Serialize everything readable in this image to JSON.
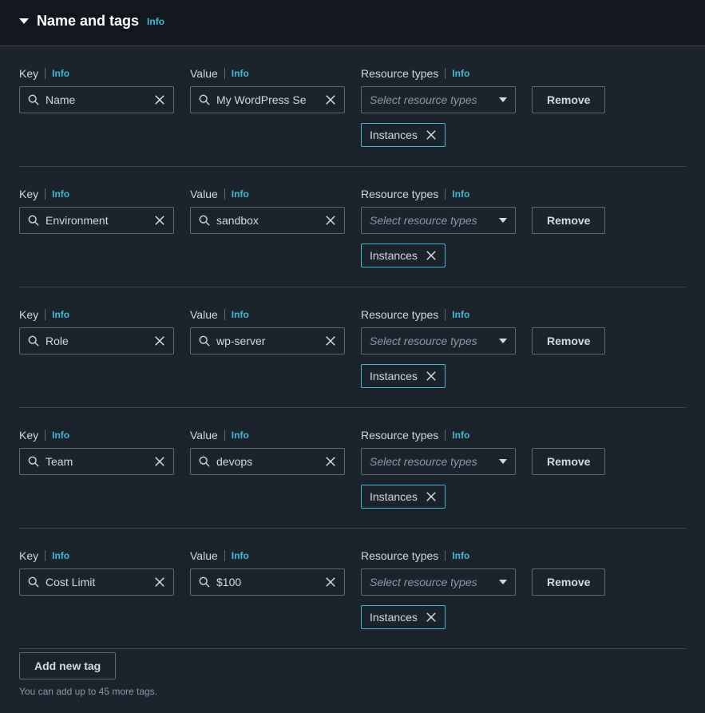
{
  "header": {
    "title": "Name and tags",
    "info": "Info"
  },
  "labels": {
    "key": "Key",
    "value": "Value",
    "resourceTypes": "Resource types",
    "info": "Info"
  },
  "select": {
    "placeholder": "Select resource types"
  },
  "buttons": {
    "remove": "Remove",
    "addNewTag": "Add new tag"
  },
  "tags": [
    {
      "key": "Name",
      "value": "My WordPress Se",
      "resourceTypes": [
        "Instances"
      ]
    },
    {
      "key": "Environment",
      "value": "sandbox",
      "resourceTypes": [
        "Instances"
      ]
    },
    {
      "key": "Role",
      "value": "wp-server",
      "resourceTypes": [
        "Instances"
      ]
    },
    {
      "key": "Team",
      "value": "devops",
      "resourceTypes": [
        "Instances"
      ]
    },
    {
      "key": "Cost Limit",
      "value": "$100",
      "resourceTypes": [
        "Instances"
      ]
    }
  ],
  "limitText": "You can add up to 45 more tags."
}
